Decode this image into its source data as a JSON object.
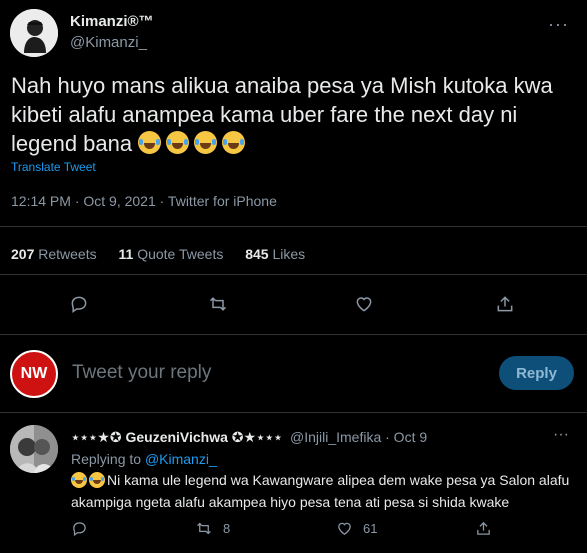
{
  "tweet": {
    "display_name": "Kimanzi®™",
    "handle": "@Kimanzi_",
    "more_icon": "more-dots-icon",
    "text": "Nah huyo mans alikua anaiba pesa ya Mish kutoka kwa kibeti alafu anampea kama uber fare the next day ni legend bana",
    "emojis": [
      "face-with-tears-of-joy",
      "face-with-tears-of-joy",
      "face-with-tears-of-joy",
      "face-with-tears-of-joy"
    ],
    "translate_label": "Translate Tweet",
    "meta": "12:14 PM · Oct 9, 2021 · Twitter for iPhone"
  },
  "stats": {
    "retweets_count": "207",
    "retweets_label": "Retweets",
    "quotes_count": "11",
    "quotes_label": "Quote Tweets",
    "likes_count": "845",
    "likes_label": "Likes"
  },
  "actions": {
    "icons": [
      "reply-icon",
      "retweet-icon",
      "like-icon",
      "share-icon"
    ]
  },
  "composer": {
    "avatar_text": "NW",
    "placeholder": "Tweet your reply",
    "reply_button": "Reply"
  },
  "reply": {
    "display_name": "⋆⋆⋆★✪ GeuzeniVichwa ✪★⋆⋆⋆",
    "handle": "@Injili_Imefika · Oct 9",
    "replying_prefix": "Replying to",
    "replying_to": "@Kimanzi_",
    "text": "Ni kama ule legend wa Kawangware alipea dem wake pesa ya Salon alafu akampiga ngeta alafu akampea hiyo pesa tena ati pesa si shida kwake",
    "retweet_count": "8",
    "like_count": "61"
  },
  "colors": {
    "background": "#000000",
    "accent": "#1d9bf0",
    "muted": "#8b98a5",
    "divider": "#2f3336"
  }
}
